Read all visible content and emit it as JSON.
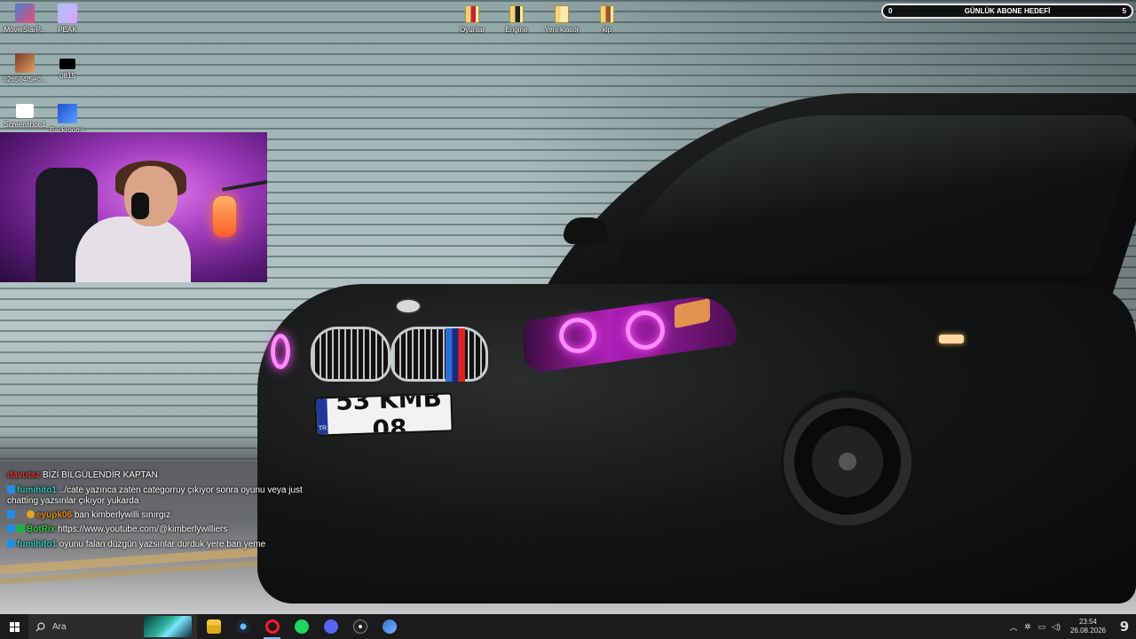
{
  "desktop_icons": {
    "movie": "MovieStarP...",
    "peak": "PEAK",
    "img1": "626584f5e0...",
    "file0815": "0815",
    "screenshot": "Screenshot 1",
    "backrooms": "Backrooms",
    "oyunlar": "Oyunlar",
    "engine": "Engine",
    "yeni_klasor": "Yeni klasör",
    "klp": "klp"
  },
  "goal": {
    "title": "GÜNLÜK ABONE HEDEFİ",
    "current": "0",
    "target": "5",
    "progress": 0.0
  },
  "plate": {
    "country": "TR",
    "number": "53 KMB 08"
  },
  "chat": [
    {
      "user": "davutsz",
      "message": "BİZİ BİLGÜLENDİR KAPTAN"
    },
    {
      "user": "fumihito1",
      "message": "../cate yazınca zaten categorruy çıkıyor sonra oyunu veya just chatting yazsınlar çıkıyor yukarda"
    },
    {
      "user": "eyupk06",
      "message": "ban kimberlywilli sınırgız"
    },
    {
      "user": "BotRix",
      "message": "https://www.youtube.com/@kimberlywilliers"
    },
    {
      "user": "fumihito1",
      "message": "oyunu falan düzgün yazsınlar durduk yere ban yeme"
    }
  ],
  "taskbar": {
    "search_placeholder": "Ara",
    "time": "23:54",
    "date": "26.08.2026",
    "notification_count": "9"
  },
  "colors": {
    "accent_magenta": "#e040e8",
    "taskbar": "#1b1b1b"
  }
}
